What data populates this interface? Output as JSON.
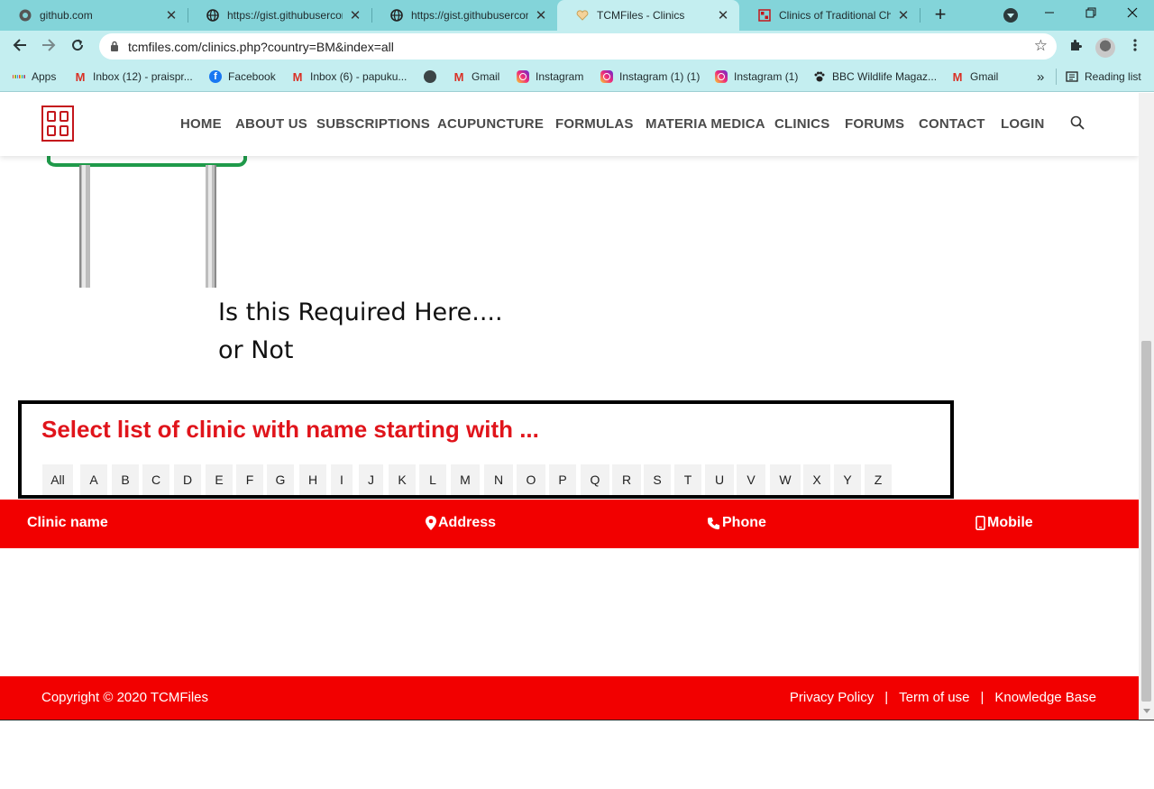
{
  "browser": {
    "tabs": [
      {
        "title": "github.com",
        "close": "✕",
        "active": false,
        "icon": "github-icon"
      },
      {
        "title": "https://gist.githubusercon",
        "close": "✕",
        "active": false,
        "icon": "globe-icon"
      },
      {
        "title": "https://gist.githubusercon",
        "close": "✕",
        "active": false,
        "icon": "globe-icon"
      },
      {
        "title": "TCMFiles - Clinics",
        "close": "✕",
        "active": true,
        "icon": "tcm-heart-icon"
      },
      {
        "title": "Clinics of Traditional Chine",
        "close": "✕",
        "active": false,
        "icon": "tcm-logo-icon"
      }
    ],
    "new_tab": "+",
    "url": "tcmfiles.com/clinics.php?country=BM&index=all",
    "bookmarks": [
      {
        "label": "Apps",
        "icon": "apps-icon"
      },
      {
        "label": "Inbox (12) - praispr...",
        "icon": "gmail-icon"
      },
      {
        "label": "Facebook",
        "icon": "facebook-icon"
      },
      {
        "label": "Inbox (6) - papuku...",
        "icon": "gmail-icon"
      },
      {
        "label": "",
        "icon": "globe-icon"
      },
      {
        "label": "Gmail",
        "icon": "gmail-icon"
      },
      {
        "label": "Instagram",
        "icon": "instagram-icon"
      },
      {
        "label": "Instagram (1) (1)",
        "icon": "instagram-icon"
      },
      {
        "label": "Instagram (1)",
        "icon": "instagram-icon"
      },
      {
        "label": "BBC Wildlife Magaz...",
        "icon": "paw-icon"
      },
      {
        "label": "Gmail",
        "icon": "gmail-icon"
      }
    ],
    "bookmarks_overflow": "»",
    "reading_list": "Reading list",
    "colors": {
      "tabstrip": "#83d4d9",
      "toolbar": "#c4eef0"
    }
  },
  "site": {
    "nav": [
      "HOME",
      "ABOUT US",
      "SUBSCRIPTIONS",
      "ACUPUNCTURE",
      "FORMULAS",
      "MATERIA MEDICA",
      "CLINICS",
      "FORUMS",
      "CONTACT",
      "LOGIN"
    ],
    "annotation_line1": "Is this Required Here....",
    "annotation_line2": "or Not",
    "alphabet_title": "Select list of clinic with name starting with ...",
    "letters": [
      "All",
      "A",
      "B",
      "C",
      "D",
      "E",
      "F",
      "G",
      "H",
      "I",
      "J",
      "K",
      "L",
      "M",
      "N",
      "O",
      "P",
      "Q",
      "R",
      "S",
      "T",
      "U",
      "V",
      "W",
      "X",
      "Y",
      "Z"
    ],
    "table_headers": {
      "clinic_name": "Clinic name",
      "address": "Address",
      "phone": "Phone",
      "mobile": "Mobile"
    },
    "footer": {
      "copyright": "Copyright © 2020 TCMFiles",
      "privacy": "Privacy Policy",
      "terms": "Term of use",
      "knowledge": "Knowledge Base",
      "separator": "|"
    },
    "colors": {
      "accent": "#f20000",
      "title_red": "#e0141b",
      "nav_text": "#4a4a4a"
    }
  }
}
